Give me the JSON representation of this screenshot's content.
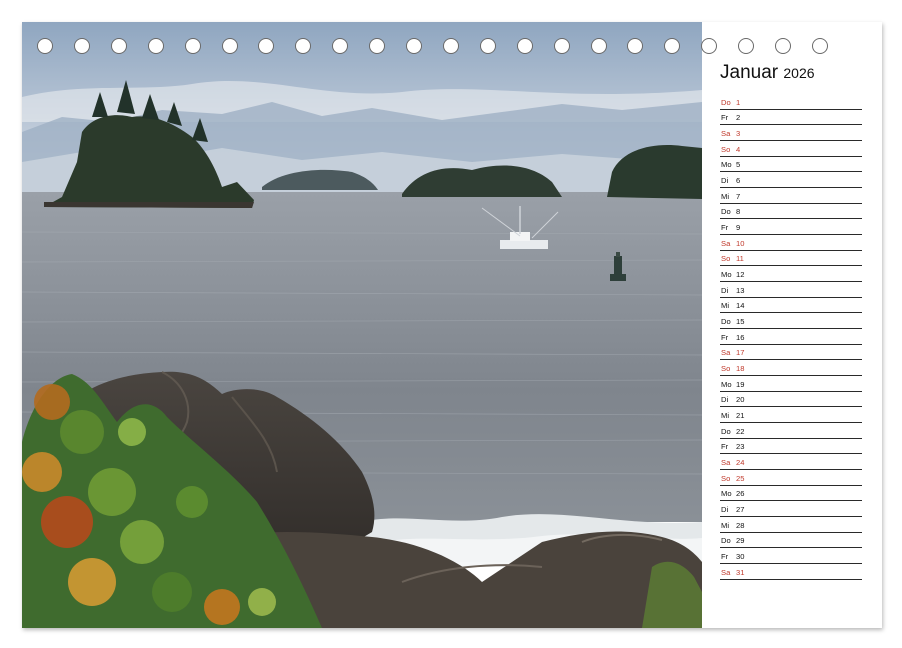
{
  "calendar": {
    "month": "Januar",
    "year": "2026",
    "days": [
      {
        "wd": "Do",
        "n": "1",
        "red": true
      },
      {
        "wd": "Fr",
        "n": "2",
        "red": false
      },
      {
        "wd": "Sa",
        "n": "3",
        "red": true
      },
      {
        "wd": "So",
        "n": "4",
        "red": true
      },
      {
        "wd": "Mo",
        "n": "5",
        "red": false
      },
      {
        "wd": "Di",
        "n": "6",
        "red": false
      },
      {
        "wd": "Mi",
        "n": "7",
        "red": false
      },
      {
        "wd": "Do",
        "n": "8",
        "red": false
      },
      {
        "wd": "Fr",
        "n": "9",
        "red": false
      },
      {
        "wd": "Sa",
        "n": "10",
        "red": true
      },
      {
        "wd": "So",
        "n": "11",
        "red": true
      },
      {
        "wd": "Mo",
        "n": "12",
        "red": false
      },
      {
        "wd": "Di",
        "n": "13",
        "red": false
      },
      {
        "wd": "Mi",
        "n": "14",
        "red": false
      },
      {
        "wd": "Do",
        "n": "15",
        "red": false
      },
      {
        "wd": "Fr",
        "n": "16",
        "red": false
      },
      {
        "wd": "Sa",
        "n": "17",
        "red": true
      },
      {
        "wd": "So",
        "n": "18",
        "red": true
      },
      {
        "wd": "Mo",
        "n": "19",
        "red": false
      },
      {
        "wd": "Di",
        "n": "20",
        "red": false
      },
      {
        "wd": "Mi",
        "n": "21",
        "red": false
      },
      {
        "wd": "Do",
        "n": "22",
        "red": false
      },
      {
        "wd": "Fr",
        "n": "23",
        "red": false
      },
      {
        "wd": "Sa",
        "n": "24",
        "red": true
      },
      {
        "wd": "So",
        "n": "25",
        "red": true
      },
      {
        "wd": "Mo",
        "n": "26",
        "red": false
      },
      {
        "wd": "Di",
        "n": "27",
        "red": false
      },
      {
        "wd": "Mi",
        "n": "28",
        "red": false
      },
      {
        "wd": "Do",
        "n": "29",
        "red": false
      },
      {
        "wd": "Fr",
        "n": "30",
        "red": false
      },
      {
        "wd": "Sa",
        "n": "31",
        "red": true
      }
    ]
  },
  "colors": {
    "weekend_holiday": "#c0392b",
    "weekday": "#111111",
    "rule_line": "#2a2a2a"
  },
  "binding": {
    "hole_count": 22
  }
}
